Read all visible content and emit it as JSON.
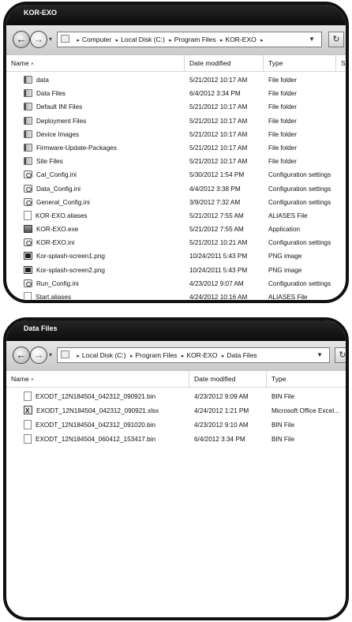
{
  "window1": {
    "title": "KOR-EXO",
    "address": [
      "Computer",
      "Local Disk (C:)",
      "Program Files",
      "KOR-EXO"
    ],
    "columns": {
      "name": "Name",
      "date": "Date modified",
      "type": "Type",
      "size": "Siz"
    },
    "files": [
      {
        "name": "data",
        "date": "5/21/2012 10:17 AM",
        "type": "File folder",
        "icon": "folder"
      },
      {
        "name": "Data Files",
        "date": "6/4/2012 3:34 PM",
        "type": "File folder",
        "icon": "folder"
      },
      {
        "name": "Default INI Files",
        "date": "5/21/2012 10:17 AM",
        "type": "File folder",
        "icon": "folder"
      },
      {
        "name": "Deployment Files",
        "date": "5/21/2012 10:17 AM",
        "type": "File folder",
        "icon": "folder"
      },
      {
        "name": "Device Images",
        "date": "5/21/2012 10:17 AM",
        "type": "File folder",
        "icon": "folder"
      },
      {
        "name": "Firmware-Update-Packages",
        "date": "5/21/2012 10:17 AM",
        "type": "File folder",
        "icon": "folder"
      },
      {
        "name": "Site Files",
        "date": "5/21/2012 10:17 AM",
        "type": "File folder",
        "icon": "folder"
      },
      {
        "name": "Cal_Config.ini",
        "date": "5/30/2012 1:54 PM",
        "type": "Configuration settings",
        "icon": "gear"
      },
      {
        "name": "Data_Config.ini",
        "date": "4/4/2012 3:38 PM",
        "type": "Configuration settings",
        "icon": "gear"
      },
      {
        "name": "General_Config.ini",
        "date": "3/9/2012 7:32 AM",
        "type": "Configuration settings",
        "icon": "gear"
      },
      {
        "name": "KOR-EXO.aliases",
        "date": "5/21/2012 7:55 AM",
        "type": "ALIASES File",
        "icon": "file"
      },
      {
        "name": "KOR-EXO.exe",
        "date": "5/21/2012 7:55 AM",
        "type": "Application",
        "icon": "exe"
      },
      {
        "name": "KOR-EXO.ini",
        "date": "5/21/2012 10:21 AM",
        "type": "Configuration settings",
        "icon": "gear"
      },
      {
        "name": "Kor-splash-screen1.png",
        "date": "10/24/2011 5:43 PM",
        "type": "PNG image",
        "icon": "img"
      },
      {
        "name": "Kor-splash-screen2.png",
        "date": "10/24/2011 5:43 PM",
        "type": "PNG image",
        "icon": "img"
      },
      {
        "name": "Run_Config.ini",
        "date": "4/23/2012 9:07 AM",
        "type": "Configuration settings",
        "icon": "gear"
      },
      {
        "name": "Start.aliases",
        "date": "4/24/2012 10:16 AM",
        "type": "ALIASES File",
        "icon": "file"
      }
    ]
  },
  "window2": {
    "title": "Data Files",
    "address": [
      "Local Disk (C:)",
      "Program Files",
      "KOR-EXO",
      "Data Files"
    ],
    "columns": {
      "name": "Name",
      "date": "Date modified",
      "type": "Type"
    },
    "files": [
      {
        "name": "EXODT_12N184504_042312_090921.bin",
        "date": "4/23/2012 9:09 AM",
        "type": "BIN File",
        "icon": "file"
      },
      {
        "name": "EXODT_12N184504_042312_090921.xlsx",
        "date": "4/24/2012 1:21 PM",
        "type": "Microsoft Office Excel...",
        "icon": "xls"
      },
      {
        "name": "EXODT_12N184504_042312_091020.bin",
        "date": "4/23/2012 9:10 AM",
        "type": "BIN File",
        "icon": "file"
      },
      {
        "name": "EXODT_12N184504_060412_153417.bin",
        "date": "6/4/2012 3:34 PM",
        "type": "BIN File",
        "icon": "file"
      }
    ]
  }
}
